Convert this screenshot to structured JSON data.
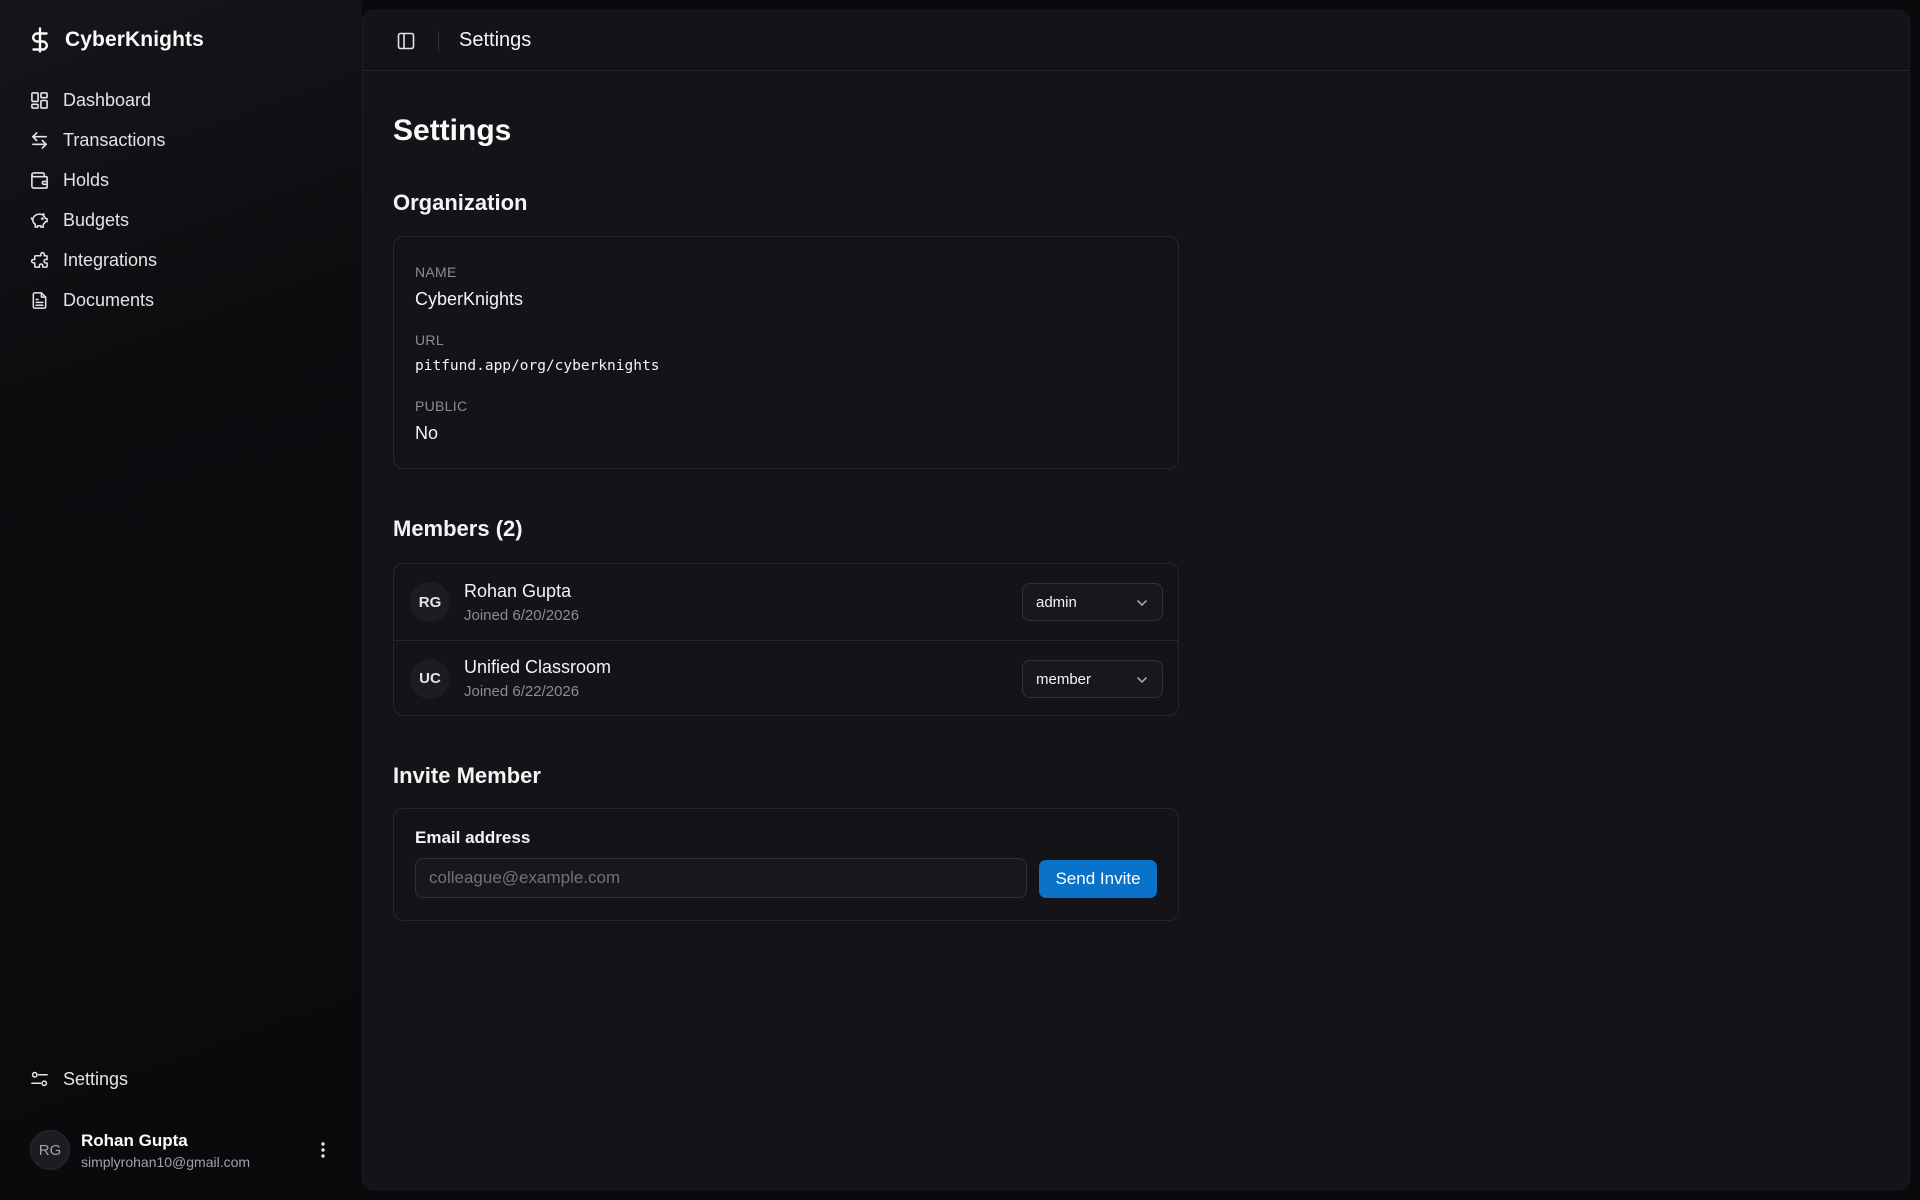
{
  "brand": {
    "name": "CyberKnights",
    "icon": "dollar-icon"
  },
  "sidebar": {
    "items": [
      {
        "label": "Dashboard",
        "icon": "dashboard-icon"
      },
      {
        "label": "Transactions",
        "icon": "arrows-icon"
      },
      {
        "label": "Holds",
        "icon": "wallet-icon"
      },
      {
        "label": "Budgets",
        "icon": "piggy-bank-icon"
      },
      {
        "label": "Integrations",
        "icon": "puzzle-icon"
      },
      {
        "label": "Documents",
        "icon": "document-icon"
      }
    ],
    "settings": {
      "label": "Settings",
      "icon": "sliders-icon"
    }
  },
  "user": {
    "initials": "RG",
    "name": "Rohan Gupta",
    "email": "simplyrohan10@gmail.com"
  },
  "topbar": {
    "title": "Settings"
  },
  "page": {
    "title": "Settings"
  },
  "organization": {
    "title": "Organization",
    "name_label": "NAME",
    "name_value": "CyberKnights",
    "url_label": "URL",
    "url_value": "pitfund.app/org/cyberknights",
    "public_label": "PUBLIC",
    "public_value": "No"
  },
  "members": {
    "title": "Members (2)",
    "list": [
      {
        "initials": "RG",
        "name": "Rohan Gupta",
        "joined": "Joined 6/20/2026",
        "role": "admin"
      },
      {
        "initials": "UC",
        "name": "Unified Classroom",
        "joined": "Joined 6/22/2026",
        "role": "member"
      }
    ]
  },
  "invite": {
    "title": "Invite Member",
    "email_label": "Email address",
    "email_placeholder": "colleague@example.com",
    "email_value": "",
    "button_label": "Send Invite"
  },
  "colors": {
    "accent": "#0a72c8",
    "background": "#0a0a0c",
    "panel": "#131318",
    "border": "#26272d"
  }
}
